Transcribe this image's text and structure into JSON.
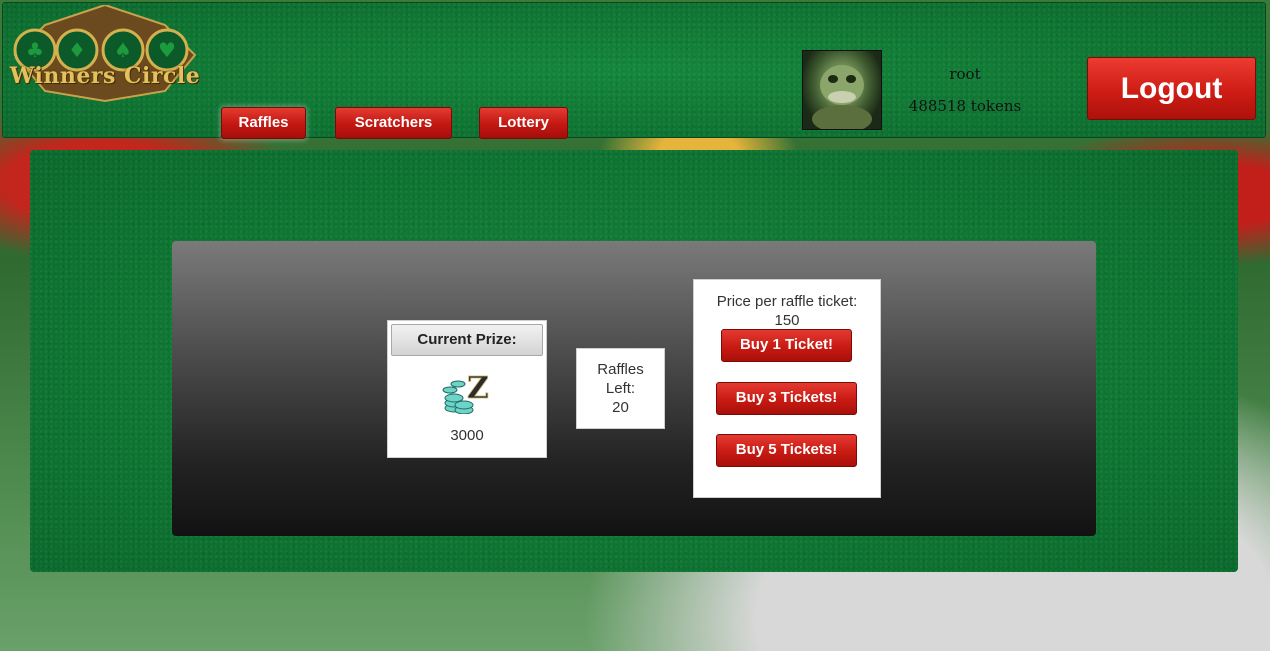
{
  "header": {
    "logo_text": "Winners Circle",
    "nav": [
      {
        "label": "Raffles",
        "active": true
      },
      {
        "label": "Scratchers",
        "active": false
      },
      {
        "label": "Lottery",
        "active": false
      }
    ],
    "user": {
      "username": "root",
      "tokens": "488518 tokens"
    },
    "logout_label": "Logout"
  },
  "raffle": {
    "prize_title": "Current Prize:",
    "prize_value": "3000",
    "raffles_left_line1": "Raffles",
    "raffles_left_line2": "Left:",
    "raffles_left_value": "20",
    "price_label": "Price per raffle ticket:",
    "price_value": "150",
    "buttons": [
      "Buy 1 Ticket!",
      "Buy 3 Tickets!",
      "Buy 5 Tickets!"
    ]
  },
  "colors": {
    "felt_green": "#0f7a35",
    "button_red": "#c81a13",
    "logo_gold": "#e2c15e"
  }
}
